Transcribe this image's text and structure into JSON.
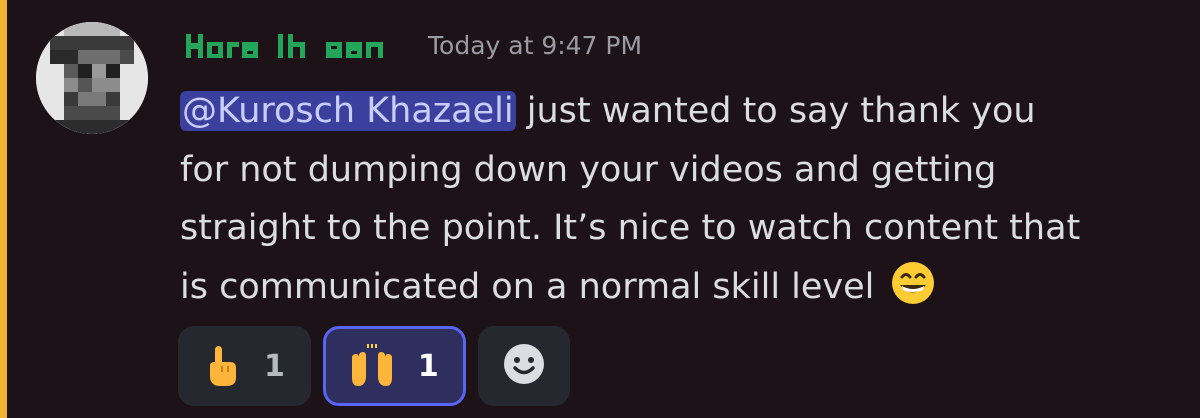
{
  "message": {
    "author": {
      "name": "Hora Ihsan",
      "color": "#23a55a"
    },
    "timestamp": "Today at 9:47 PM",
    "mention": "@Kurosch Khazaeli",
    "lines": [
      " just wanted to say thank you",
      "for not dumping down your videos and getting",
      "straight to the point. It’s nice to watch content that",
      "is communicated on a normal skill level"
    ],
    "inline_emoji": "grinning-face-with-smiling-eyes"
  },
  "reactions": [
    {
      "emoji": "pointing-hand",
      "count": "1",
      "active": false
    },
    {
      "emoji": "raising-hands",
      "count": "1",
      "active": true
    }
  ],
  "add_reaction": {
    "icon": "add-reaction-smiley-icon"
  },
  "colors": {
    "mention_bar": "#f0b232",
    "mention_bg": "#3b3f9e",
    "active_border": "#5865f2"
  }
}
